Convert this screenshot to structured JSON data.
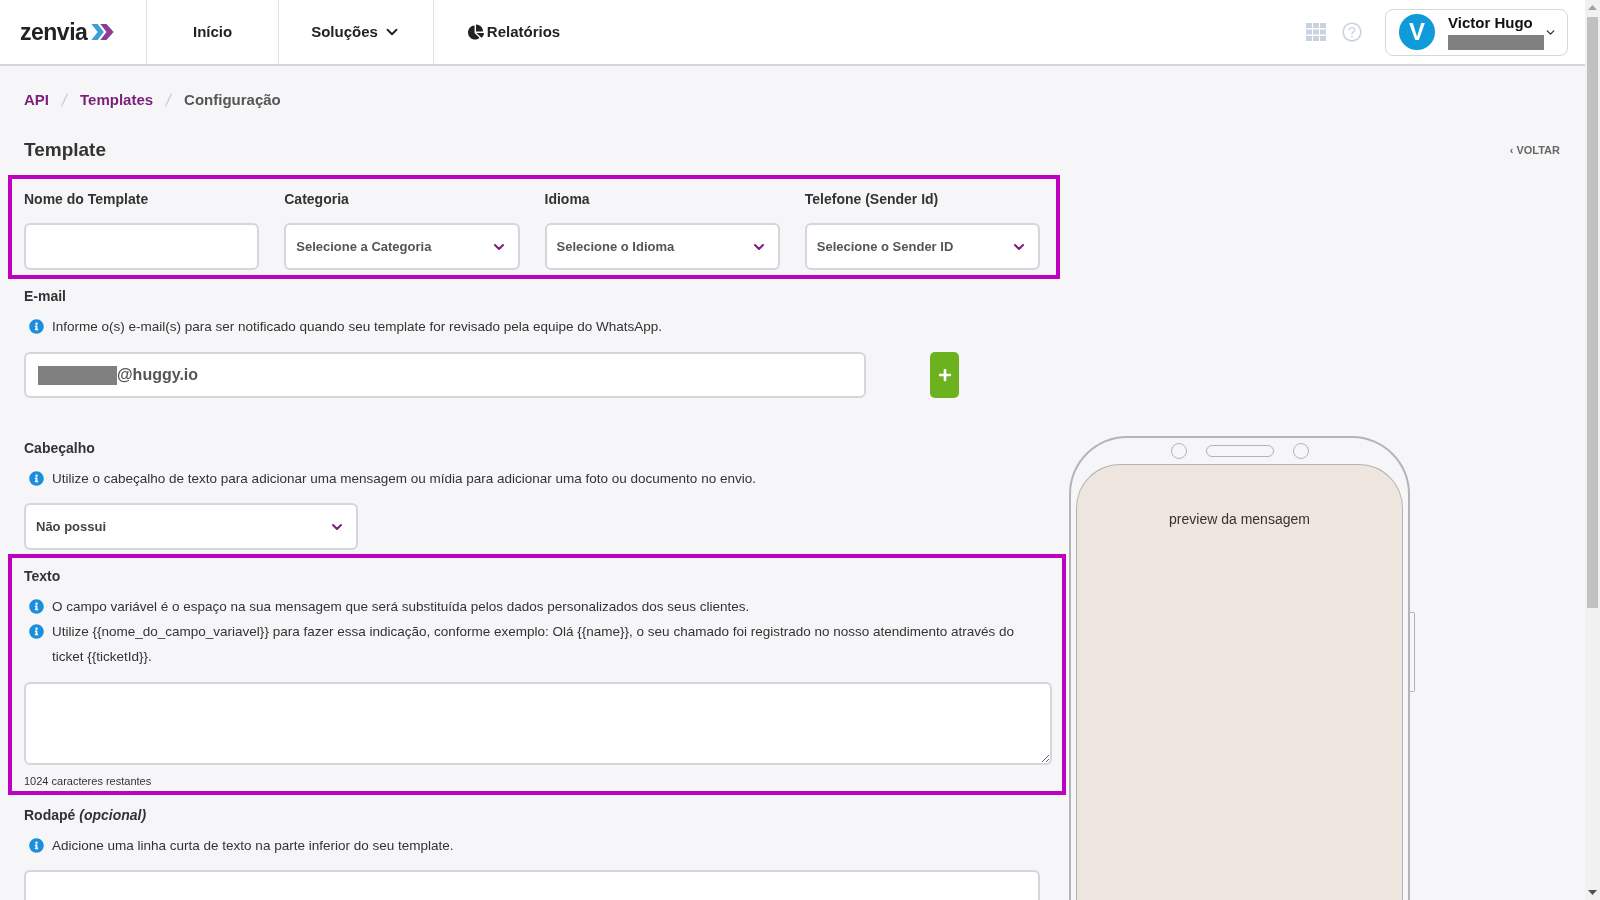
{
  "header": {
    "logo": "zenvia",
    "nav": [
      {
        "label": "Início",
        "kind": "link"
      },
      {
        "label": "Soluções",
        "kind": "dropdown"
      },
      {
        "label": "Relatórios",
        "kind": "icon_link"
      }
    ],
    "user": {
      "initial": "V",
      "name": "Victor Hugo"
    }
  },
  "breadcrumb": [
    {
      "label": "API",
      "current": false
    },
    {
      "label": "Templates",
      "current": false
    },
    {
      "label": "Configuração",
      "current": true
    }
  ],
  "page": {
    "title": "Template",
    "back_link": "‹ VOLTAR"
  },
  "template_info": {
    "highlighted": true,
    "fields": [
      {
        "label": "Nome do Template",
        "kind": "text"
      },
      {
        "label": "Categoria",
        "kind": "select",
        "placeholder": "Selecione a Categoria"
      },
      {
        "label": "Idioma",
        "kind": "select",
        "placeholder": "Selecione o Idioma"
      },
      {
        "label": "Telefone (Sender Id)",
        "kind": "select",
        "placeholder": "Selecione o Sender ID"
      }
    ]
  },
  "email": {
    "label": "E-mail",
    "info": [
      "Informe o(s) e-mail(s) para ser notificado quando seu template for revisado pela equipe do WhatsApp."
    ],
    "value": "@huggy.io"
  },
  "message_header": {
    "label": "Cabeçalho",
    "info": [
      "Utilize o cabeçalho de texto para adicionar uma mensagem ou mídia para adicionar uma foto ou documento no envio."
    ],
    "value": "Não possui"
  },
  "message_text": {
    "highlighted": true,
    "label": "Texto",
    "info": [
      "O campo variável é o espaço na sua mensagem que será substituída pelos dados personalizados dos seus clientes.",
      "Utilize {{nome_do_campo_variavel}} para fazer essa indicação, conforme exemplo: Olá {{name}}, o seu chamado foi registrado no nosso atendimento através do ticket {{ticketId}}."
    ],
    "counter": "1024 caracteres restantes"
  },
  "footer": {
    "label": "Rodapé *(opcional)*",
    "info": [
      "Adicione uma linha curta de texto na parte inferior do seu template."
    ]
  },
  "preview": {
    "text": "preview da mensagem"
  }
}
